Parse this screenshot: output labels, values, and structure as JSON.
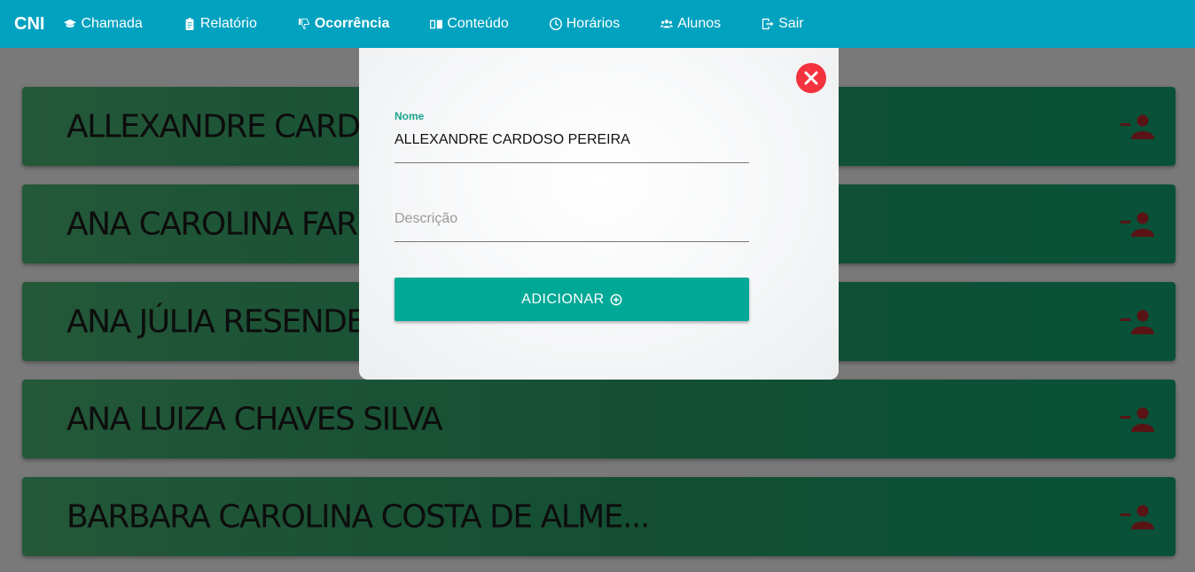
{
  "navbar": {
    "brand": "CNI",
    "items": [
      {
        "label": "Chamada",
        "icon": "graduation-cap-icon"
      },
      {
        "label": "Relatório",
        "icon": "clipboard-icon"
      },
      {
        "label": "Ocorrência",
        "icon": "thumbs-down-icon",
        "active": true
      },
      {
        "label": "Conteúdo",
        "icon": "book-open-icon"
      },
      {
        "label": "Horários",
        "icon": "clock-icon"
      },
      {
        "label": "Alunos",
        "icon": "users-icon"
      },
      {
        "label": "Sair",
        "icon": "sign-out-icon"
      }
    ]
  },
  "students": [
    {
      "name": "ALLEXANDRE CARDOSO PEREIRA"
    },
    {
      "name": "ANA CAROLINA FARIA"
    },
    {
      "name": "ANA JÚLIA RESENDE"
    },
    {
      "name": "ANA LUIZA CHAVES SILVA"
    },
    {
      "name": "BARBARA CAROLINA COSTA DE ALME..."
    }
  ],
  "modal": {
    "name_label": "Nome",
    "name_value": "ALLEXANDRE CARDOSO PEREIRA",
    "description_placeholder": "Descrição",
    "add_label": "ADICIONAR"
  },
  "colors": {
    "navbar": "#00a2c0",
    "card_start": "#47b071",
    "card_end": "#11a371",
    "remove_icon": "#b5262b",
    "close_button": "#f4333f",
    "add_button": "#00a896",
    "label_accent": "#1aa38a"
  }
}
